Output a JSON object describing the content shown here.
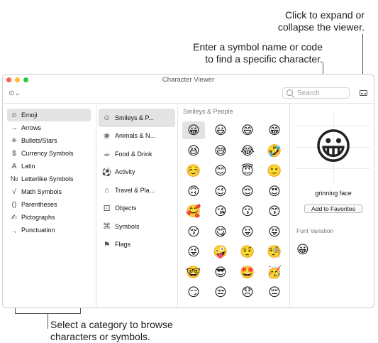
{
  "callouts": {
    "expand_line1": "Click to expand or",
    "expand_line2": "collapse the viewer.",
    "search_line1": "Enter a symbol name or code",
    "search_line2": "to find a specific character.",
    "category_line1": "Select a category to browse",
    "category_line2": "characters or symbols."
  },
  "window": {
    "title": "Character Viewer",
    "traffic_lights": [
      "#ff5f57",
      "#febc2e",
      "#28c840"
    ]
  },
  "toolbar": {
    "more_label": "⊙⌄",
    "search_placeholder": "Search"
  },
  "sidebar": {
    "items": [
      {
        "icon": "☺",
        "label": "Emoji",
        "selected": true
      },
      {
        "icon": "→",
        "label": "Arrows"
      },
      {
        "icon": "✳",
        "label": "Bullets/Stars"
      },
      {
        "icon": "$",
        "label": "Currency Symbols"
      },
      {
        "icon": "A",
        "label": "Latin"
      },
      {
        "icon": "№",
        "label": "Letterlike Symbols"
      },
      {
        "icon": "√",
        "label": "Math Symbols"
      },
      {
        "icon": "()",
        "label": "Parentheses"
      },
      {
        "icon": "✍",
        "label": "Pictographs"
      },
      {
        "icon": ".,",
        "label": "Punctuation"
      }
    ]
  },
  "categories": {
    "items": [
      {
        "icon": "☺",
        "label": "Smileys & P...",
        "selected": true
      },
      {
        "icon": "❀",
        "label": "Animals & N..."
      },
      {
        "icon": "☕",
        "label": "Food & Drink"
      },
      {
        "icon": "⚽",
        "label": "Activity"
      },
      {
        "icon": "⌂",
        "label": "Travel & Pla..."
      },
      {
        "icon": "⚀",
        "label": "Objects"
      },
      {
        "icon": "⌘",
        "label": "Symbols"
      },
      {
        "icon": "⚑",
        "label": "Flags"
      }
    ]
  },
  "emoji_grid": {
    "title": "Smileys & People",
    "rows": [
      [
        "😀",
        "😃",
        "😄",
        "😁"
      ],
      [
        "😆",
        "😅",
        "😂",
        "🤣"
      ],
      [
        "☺️",
        "😊",
        "😇",
        "🙂"
      ],
      [
        "🙃",
        "😉",
        "😌",
        "😍"
      ],
      [
        "🥰",
        "😘",
        "😗",
        "😙"
      ],
      [
        "😚",
        "😋",
        "😛",
        "😝"
      ],
      [
        "😜",
        "🤪",
        "🤨",
        "🧐"
      ],
      [
        "🤓",
        "😎",
        "🤩",
        "🥳"
      ],
      [
        "😏",
        "😒",
        "😞",
        "😔"
      ]
    ]
  },
  "detail": {
    "emoji": "😀",
    "name": "grinning face",
    "favorites_label": "Add to Favorites",
    "font_variation_label": "Font Variation",
    "variation_emoji": "😀"
  }
}
